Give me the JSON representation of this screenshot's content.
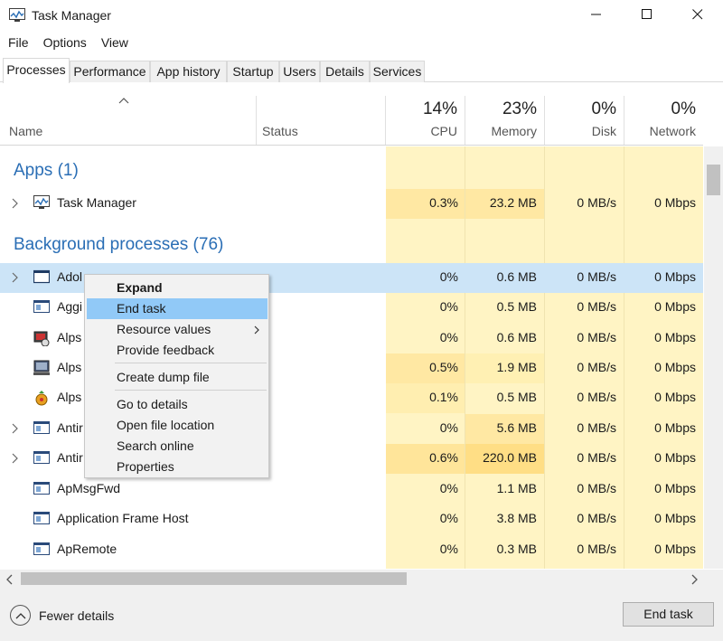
{
  "window": {
    "title": "Task Manager",
    "icon": "task-manager-icon",
    "controls": [
      "minimize-icon",
      "maximize-icon",
      "close-icon"
    ]
  },
  "menu": [
    "File",
    "Options",
    "View"
  ],
  "tabs": [
    "Processes",
    "Performance",
    "App history",
    "Startup",
    "Users",
    "Details",
    "Services"
  ],
  "active_tab": "Processes",
  "columns": {
    "name": "Name",
    "status": "Status",
    "cpu": {
      "pct": "14%",
      "label": "CPU"
    },
    "memory": {
      "pct": "23%",
      "label": "Memory"
    },
    "disk": {
      "pct": "0%",
      "label": "Disk"
    },
    "network": {
      "pct": "0%",
      "label": "Network"
    }
  },
  "groups": {
    "apps": "Apps (1)",
    "background": "Background processes (76)"
  },
  "app_rows": [
    {
      "name": "Task Manager",
      "cpu": "0.3%",
      "memory": "23.2 MB",
      "disk": "0 MB/s",
      "network": "0 Mbps"
    }
  ],
  "bg_rows": [
    {
      "name": "Adol",
      "cpu": "0%",
      "memory": "0.6 MB",
      "disk": "0 MB/s",
      "network": "0 Mbps"
    },
    {
      "name": "Aggi",
      "cpu": "0%",
      "memory": "0.5 MB",
      "disk": "0 MB/s",
      "network": "0 Mbps"
    },
    {
      "name": "Alps",
      "cpu": "0%",
      "memory": "0.6 MB",
      "disk": "0 MB/s",
      "network": "0 Mbps"
    },
    {
      "name": "Alps",
      "cpu": "0.5%",
      "memory": "1.9 MB",
      "disk": "0 MB/s",
      "network": "0 Mbps"
    },
    {
      "name": "Alps",
      "cpu": "0.1%",
      "memory": "0.5 MB",
      "disk": "0 MB/s",
      "network": "0 Mbps"
    },
    {
      "name": "Antir",
      "cpu": "0%",
      "memory": "5.6 MB",
      "disk": "0 MB/s",
      "network": "0 Mbps"
    },
    {
      "name": "Antir",
      "cpu": "0.6%",
      "memory": "220.0 MB",
      "disk": "0 MB/s",
      "network": "0 Mbps"
    },
    {
      "name": "ApMsgFwd",
      "cpu": "0%",
      "memory": "1.1 MB",
      "disk": "0 MB/s",
      "network": "0 Mbps"
    },
    {
      "name": "Application Frame Host",
      "cpu": "0%",
      "memory": "3.8 MB",
      "disk": "0 MB/s",
      "network": "0 Mbps"
    },
    {
      "name": "ApRemote",
      "cpu": "0%",
      "memory": "0.3 MB",
      "disk": "0 MB/s",
      "network": "0 Mbps"
    }
  ],
  "context_menu": {
    "items": [
      {
        "label": "Expand"
      },
      {
        "label": "End task"
      },
      {
        "label": "Resource values"
      },
      {
        "label": "Provide feedback"
      },
      {
        "label": "Create dump file"
      },
      {
        "label": "Go to details"
      },
      {
        "label": "Open file location"
      },
      {
        "label": "Search online"
      },
      {
        "label": "Properties"
      }
    ]
  },
  "footer": {
    "fewer_details": "Fewer details",
    "end_task": "End task"
  },
  "colors": {
    "group_title": "#2a6eb5",
    "heat_light": "#fff4c4",
    "selected_row": "#cce4f7",
    "menu_highlight": "#91c9f7"
  }
}
